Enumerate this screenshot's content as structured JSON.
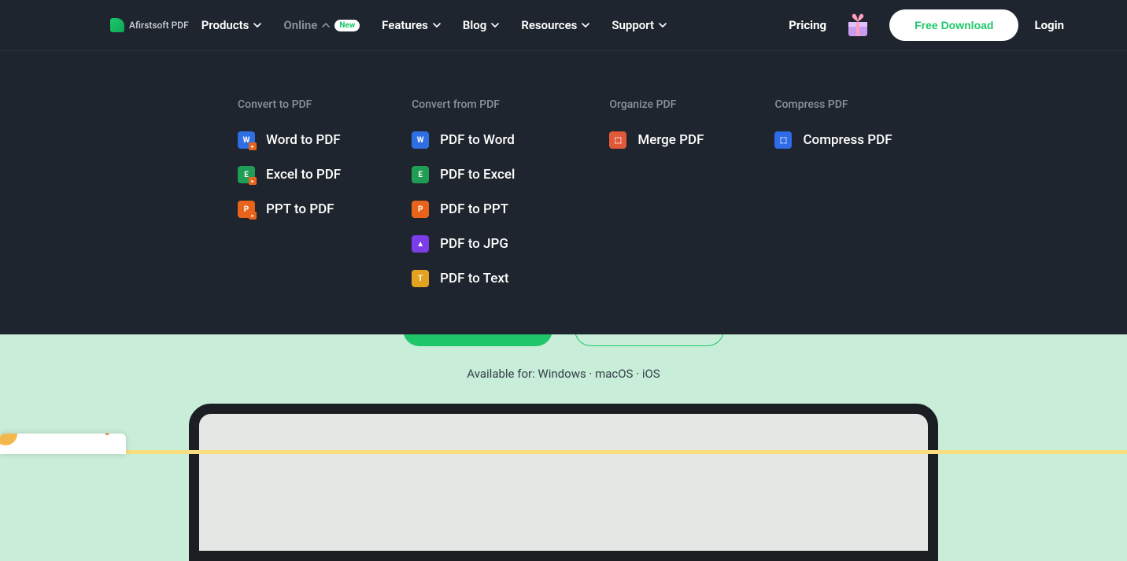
{
  "brand": "Afirstsoft PDF",
  "nav": {
    "products": "Products",
    "online": "Online",
    "online_badge": "New",
    "features": "Features",
    "blog": "Blog",
    "resources": "Resources",
    "support": "Support"
  },
  "header": {
    "pricing": "Pricing",
    "free_download": "Free Download",
    "login": "Login"
  },
  "megamenu": {
    "col1": {
      "title": "Convert to PDF",
      "items": [
        {
          "label": "Word to PDF",
          "icon": "word"
        },
        {
          "label": "Excel to PDF",
          "icon": "excel"
        },
        {
          "label": "PPT to PDF",
          "icon": "ppt"
        }
      ]
    },
    "col2": {
      "title": "Convert from PDF",
      "items": [
        {
          "label": "PDF to Word",
          "icon": "word"
        },
        {
          "label": "PDF to Excel",
          "icon": "excel"
        },
        {
          "label": "PDF to PPT",
          "icon": "ppt"
        },
        {
          "label": "PDF to JPG",
          "icon": "jpg"
        },
        {
          "label": "PDF to Text",
          "icon": "text"
        }
      ]
    },
    "col3": {
      "title": "Organize PDF",
      "items": [
        {
          "label": "Merge PDF",
          "icon": "merge"
        }
      ]
    },
    "col4": {
      "title": "Compress PDF",
      "items": [
        {
          "label": "Compress PDF",
          "icon": "compress"
        }
      ]
    }
  },
  "hero": {
    "available": "Available for: Windows · macOS · iOS"
  }
}
